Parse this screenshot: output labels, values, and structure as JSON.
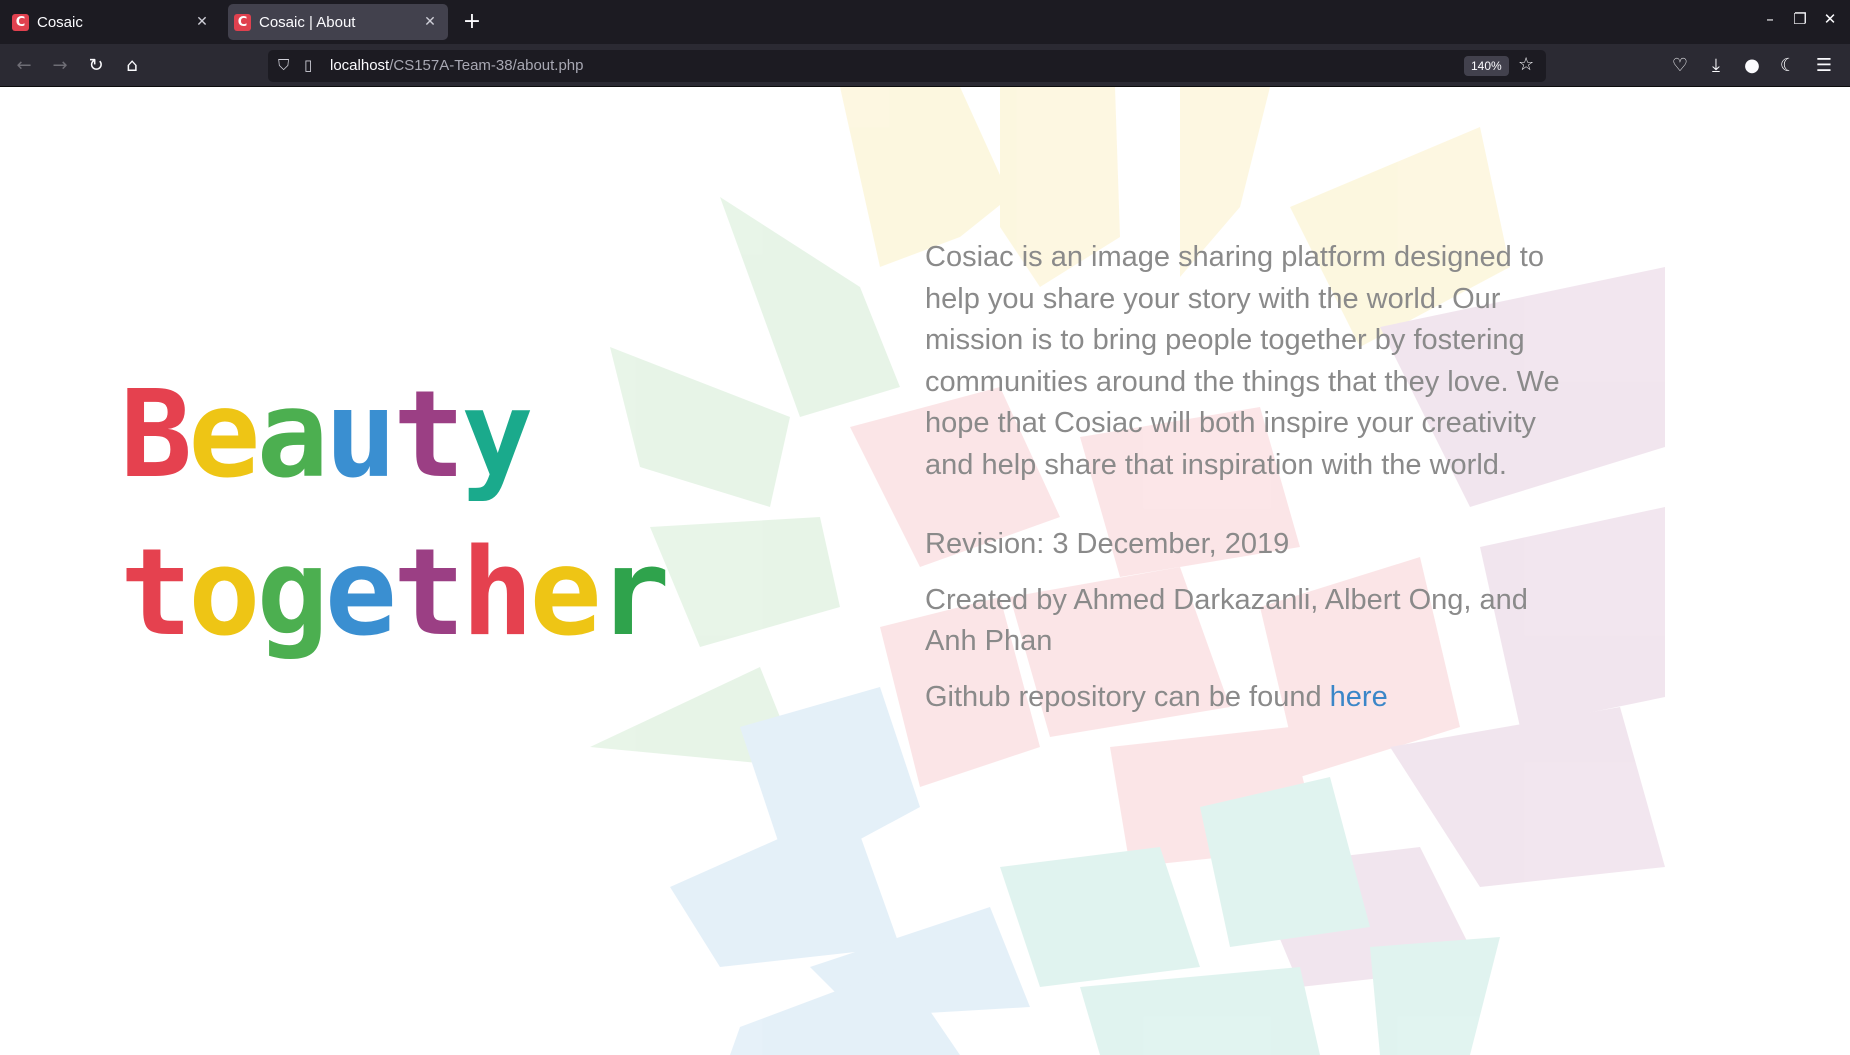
{
  "browser": {
    "tabs": [
      {
        "title": "Cosaic",
        "favicon": "C",
        "active": false
      },
      {
        "title": "Cosaic | About",
        "favicon": "C",
        "active": true
      }
    ],
    "url_host": "localhost",
    "url_path": "/CS157A-Team-38/about.php",
    "zoom": "140%"
  },
  "hero": {
    "word1": [
      "B",
      "e",
      "a",
      "u",
      "t",
      "y"
    ],
    "word2": [
      "t",
      "o",
      "g",
      "e",
      "t",
      "h",
      "e",
      "r"
    ],
    "colors1": [
      "#e5414f",
      "#eec515",
      "#4caf50",
      "#3a8fd1",
      "#9b3f84",
      "#1aaa8c"
    ],
    "colors2": [
      "#e5414f",
      "#eec515",
      "#4caf50",
      "#3a8fd1",
      "#9b3f84",
      "#e5414f",
      "#eec515",
      "#2fa34c"
    ]
  },
  "about": {
    "description": "Cosiac is an image sharing platform designed to help you share your story with the world. Our mission is to bring people together by fostering communities around the things that they love. We hope that Cosiac will both inspire your creativity and help share that inspiration with the world.",
    "revision": "Revision: 3 December, 2019",
    "created_by": "Created by Ahmed Darkazanli, Albert Ong, and Anh Phan",
    "github_text": "Github repository can be found",
    "github_link": "here"
  },
  "colors": {
    "link": "#3a86c8",
    "body_text": "#8a8a8a"
  }
}
